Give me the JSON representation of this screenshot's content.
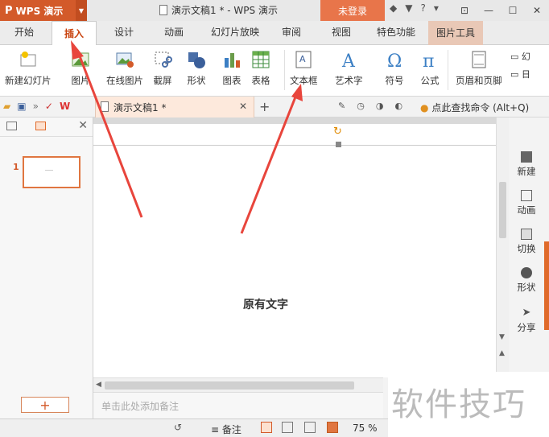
{
  "titlebar": {
    "app_logo": "P",
    "app_name": "WPS 演示",
    "doc_title": "演示文稿1 * - WPS 演示",
    "login_label": "未登录",
    "help_label": "?",
    "brand_color": "#d35a2a"
  },
  "tabs": [
    {
      "label": "开始"
    },
    {
      "label": "插入"
    },
    {
      "label": "设计"
    },
    {
      "label": "动画"
    },
    {
      "label": "幻灯片放映"
    },
    {
      "label": "审阅"
    },
    {
      "label": "视图"
    },
    {
      "label": "特色功能"
    },
    {
      "label": "图片工具"
    }
  ],
  "ribbon": {
    "new_slide": "新建幻灯片",
    "picture": "图片",
    "online_picture": "在线图片",
    "screenshot": "截屏",
    "shape": "形状",
    "chart": "图表",
    "table": "表格",
    "textbox": "文本框",
    "wordart": "艺术字",
    "symbol": "符号",
    "formula": "公式",
    "header_footer": "页眉和页脚",
    "small1": "幻",
    "small2": "日"
  },
  "quickbar": {
    "doc_tab": "演示文稿1 *",
    "find_command": "点此查找命令 (Alt+Q)"
  },
  "leftpanel": {
    "slide_number": "1"
  },
  "slide": {
    "text": "原有文字"
  },
  "rightpanel": {
    "items": [
      {
        "label": "新建"
      },
      {
        "label": "动画"
      },
      {
        "label": "切换"
      },
      {
        "label": "形状"
      },
      {
        "label": "分享"
      }
    ]
  },
  "notes": {
    "placeholder": "单击此处添加备注"
  },
  "status": {
    "notes_label": "备注",
    "zoom": "75 %"
  },
  "watermark": {
    "text": "软件技巧"
  },
  "annotation_color": "#e8453c"
}
